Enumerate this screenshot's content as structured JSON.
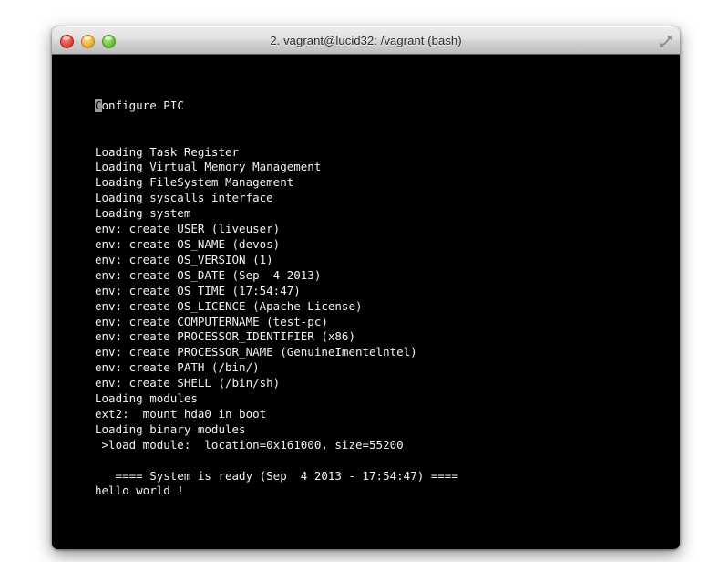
{
  "window": {
    "title": "2. vagrant@lucid32: /vagrant (bash)",
    "controls": {
      "close_label": "",
      "minimize_label": "",
      "zoom_label": "",
      "fullscreen_label": ""
    }
  },
  "terminal": {
    "background_color": "#000000",
    "text_color": "#f2f2f2",
    "cursor_color": "#9a9a9a",
    "cursor_char": "C",
    "first_line_rest": "onfigure PIC",
    "lines": [
      "Loading Task Register",
      "Loading Virtual Memory Management",
      "Loading FileSystem Management",
      "Loading syscalls interface",
      "Loading system",
      "env: create USER (liveuser)",
      "env: create OS_NAME (devos)",
      "env: create OS_VERSION (1)",
      "env: create OS_DATE (Sep  4 2013)",
      "env: create OS_TIME (17:54:47)",
      "env: create OS_LICENCE (Apache License)",
      "env: create COMPUTERNAME (test-pc)",
      "env: create PROCESSOR_IDENTIFIER (x86)",
      "env: create PROCESSOR_NAME (GenuineImentelntel)",
      "env: create PATH (/bin/)",
      "env: create SHELL (/bin/sh)",
      "Loading modules",
      "ext2:  mount hda0 in boot",
      "Loading binary modules",
      " >load module:  location=0x161000, size=55200",
      "",
      "   ==== System is ready (Sep  4 2013 - 17:54:47) ====",
      "hello world !"
    ]
  }
}
